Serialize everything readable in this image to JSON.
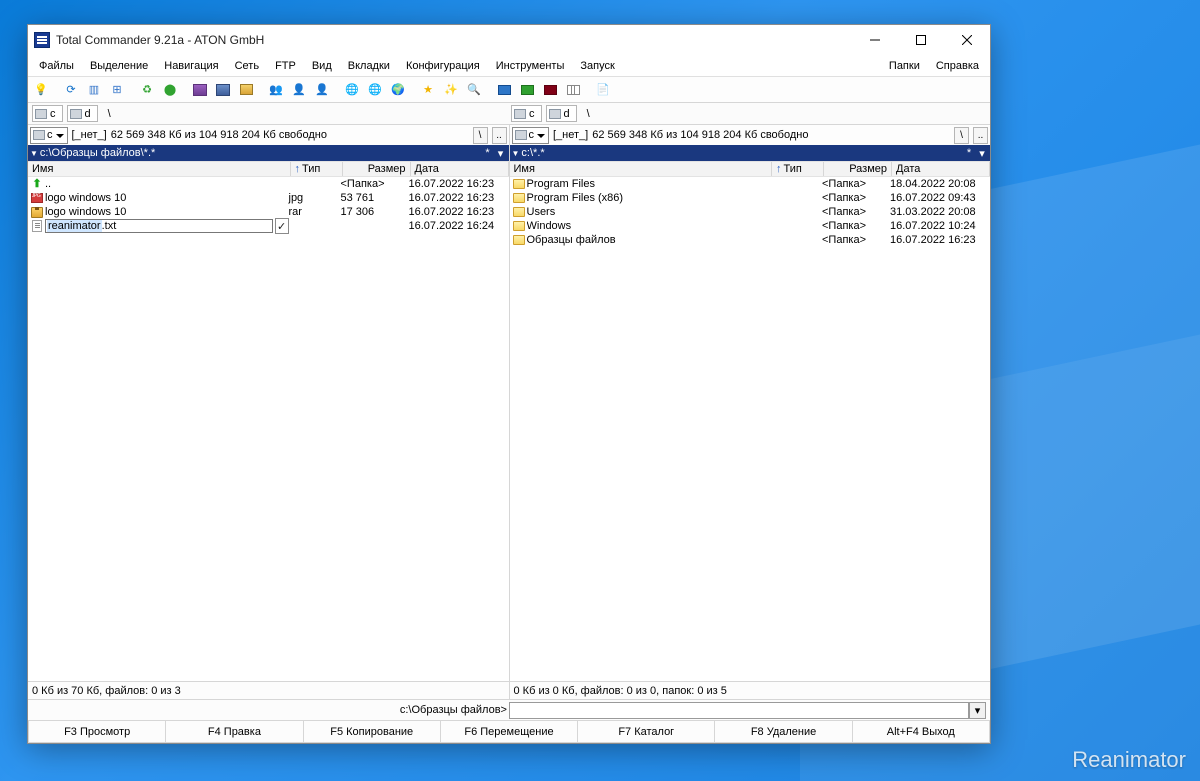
{
  "watermark": "Reanimator",
  "window": {
    "title": "Total Commander 9.21a - ATON GmbH"
  },
  "menus": {
    "files": "Файлы",
    "selection": "Выделение",
    "navigation": "Навигация",
    "net": "Сеть",
    "ftp": "FTP",
    "view": "Вид",
    "tabs": "Вкладки",
    "config": "Конфигурация",
    "tools": "Инструменты",
    "start": "Запуск",
    "folders": "Папки",
    "help": "Справка"
  },
  "drives": {
    "c": "c",
    "d": "d",
    "root": "\\"
  },
  "left": {
    "drive_sel": "c",
    "drive_label": "[_нет_]",
    "drive_info": "62 569 348 Кб из 104 918 204 Кб свободно",
    "path": "c:\\Образцы файлов\\*.*",
    "cols": {
      "name": "Имя",
      "type": "Тип",
      "size": "Размер",
      "date": "Дата"
    },
    "up": "..",
    "rows": [
      {
        "name": "logo windows 10",
        "type": "jpg",
        "size": "53 761",
        "date": "16.07.2022 16:23"
      },
      {
        "name": "logo windows 10",
        "type": "rar",
        "size": "17 306",
        "date": "16.07.2022 16:23"
      }
    ],
    "up_size": "<Папка>",
    "up_date": "16.07.2022 16:23",
    "rename": {
      "selected": "reanimator",
      "ext": ".txt",
      "date": "16.07.2022 16:24"
    },
    "status": "0 Кб из 70 Кб, файлов: 0 из 3"
  },
  "right": {
    "drive_sel": "c",
    "drive_label": "[_нет_]",
    "drive_info": "62 569 348 Кб из 104 918 204 Кб свободно",
    "path": "c:\\*.*",
    "cols": {
      "name": "Имя",
      "type": "Тип",
      "size": "Размер",
      "date": "Дата"
    },
    "rows": [
      {
        "name": "Program Files",
        "size": "<Папка>",
        "date": "18.04.2022 20:08"
      },
      {
        "name": "Program Files (x86)",
        "size": "<Папка>",
        "date": "16.07.2022 09:43"
      },
      {
        "name": "Users",
        "size": "<Папка>",
        "date": "31.03.2022 20:08"
      },
      {
        "name": "Windows",
        "size": "<Папка>",
        "date": "16.07.2022 10:24"
      },
      {
        "name": "Образцы файлов",
        "size": "<Папка>",
        "date": "16.07.2022 16:23"
      }
    ],
    "status": "0 Кб из 0 Кб, файлов: 0 из 0, папок: 0 из 5"
  },
  "cmdline": {
    "prompt": "c:\\Образцы файлов>"
  },
  "footer": {
    "f3": "F3 Просмотр",
    "f4": "F4 Правка",
    "f5": "F5 Копирование",
    "f6": "F6 Перемещение",
    "f7": "F7 Каталог",
    "f8": "F8 Удаление",
    "exit": "Alt+F4 Выход"
  },
  "nav_btns": {
    "back": "\\",
    "dot": ".."
  }
}
